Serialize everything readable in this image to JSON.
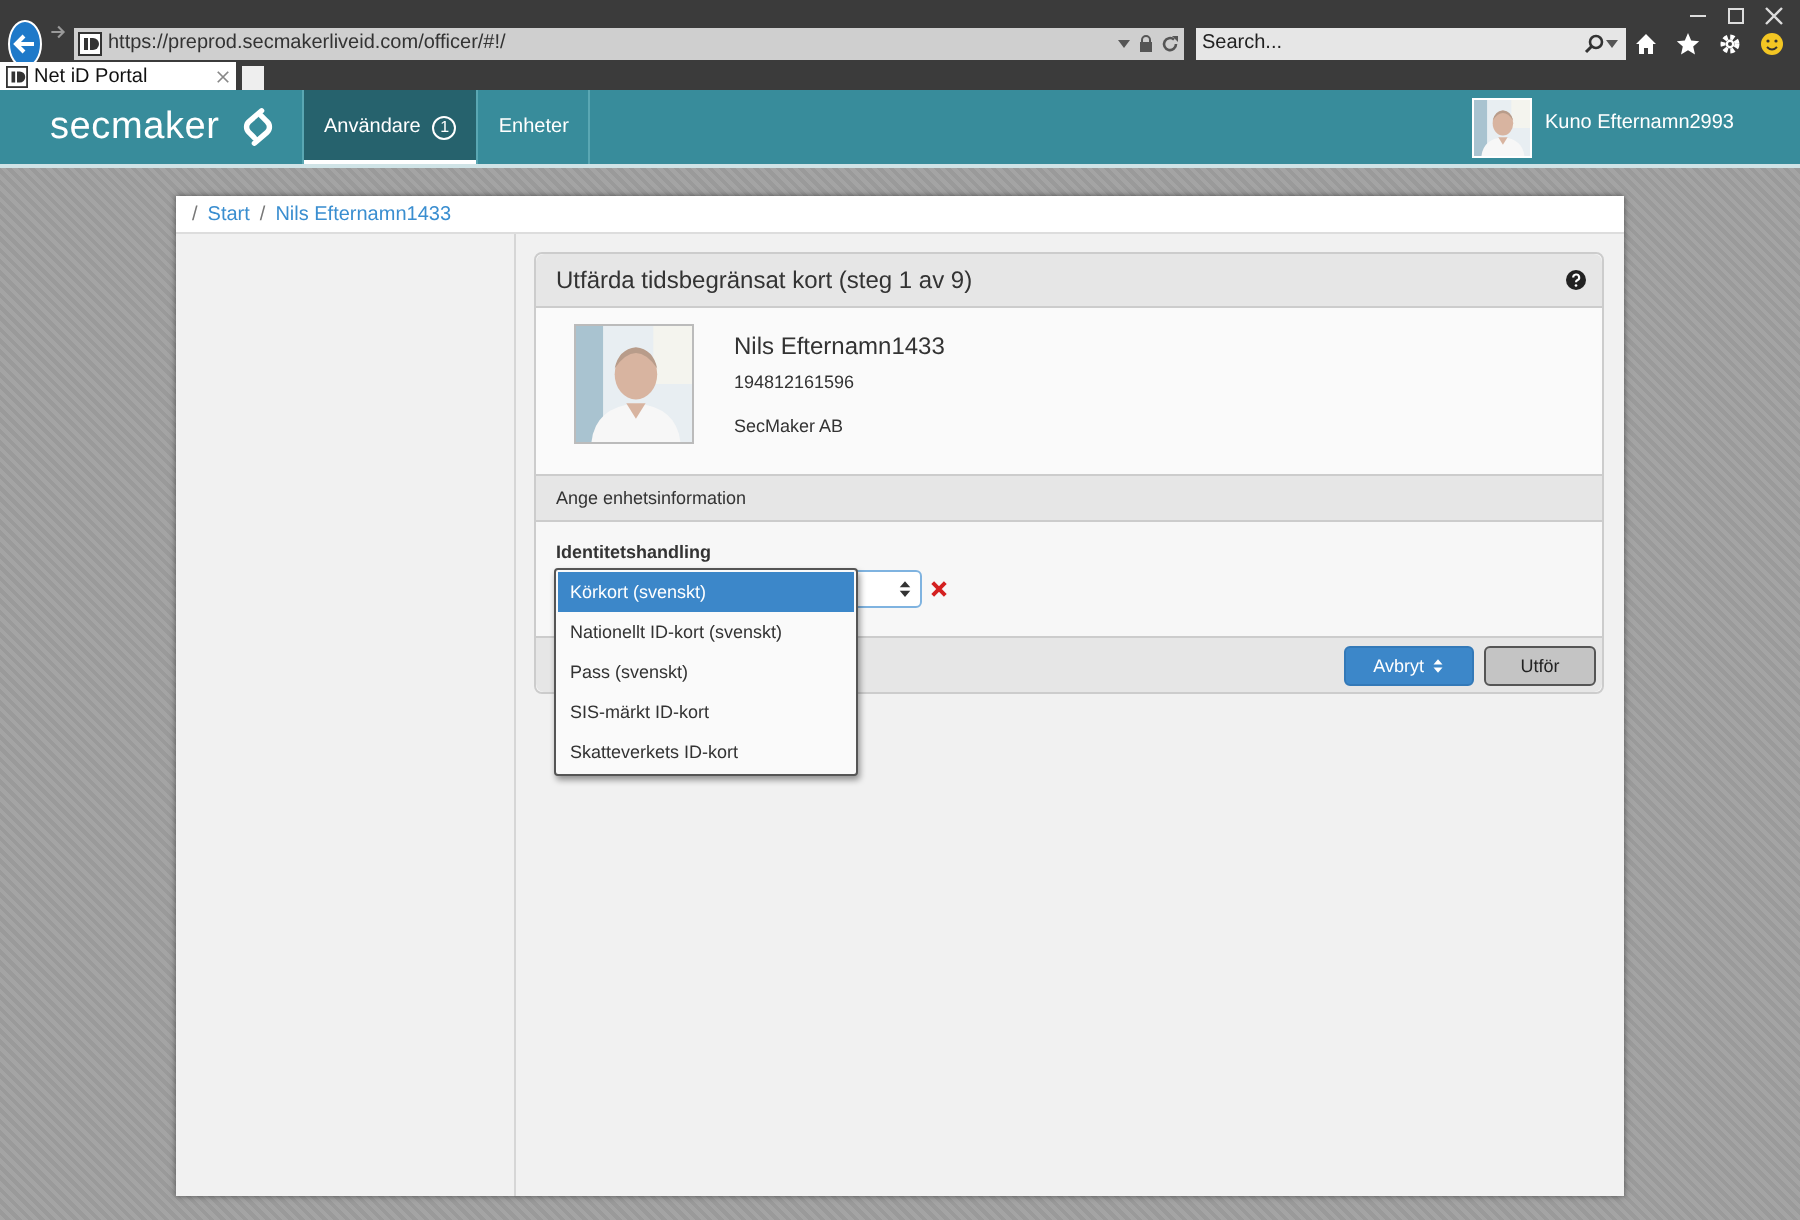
{
  "browser": {
    "address": "https://preprod.secmakerliveid.com/officer/#!/",
    "search": {
      "placeholder": "Search..."
    },
    "tabs": [
      {
        "label": "Net iD Portal",
        "selected": true
      }
    ]
  },
  "header": {
    "logo": "secmaker",
    "nav": [
      {
        "label": "Användare",
        "badge": "1",
        "selected": true
      },
      {
        "label": "Enheter",
        "selected": false
      }
    ],
    "user": "Kuno Efternamn2993"
  },
  "breadcrumb": [
    {
      "separator": "/",
      "label": "Start"
    },
    {
      "separator": "/",
      "label": "Nils Efternamn1433"
    }
  ],
  "card": {
    "title": "Utfärda tidsbegränsat kort (steg 1 av 9)",
    "person": {
      "name": "Nils Efternamn1433",
      "number": "194812161596",
      "organization": "SecMaker AB"
    },
    "section": "Ange enhetsinformation",
    "field": {
      "label": "Identitetshandling",
      "expanded": true,
      "options": [
        {
          "label": "Körkort (svenskt)",
          "selected": true
        },
        {
          "label": "Nationellt ID-kort (svenskt)",
          "selected": false
        },
        {
          "label": "Pass (svenskt)",
          "selected": false
        },
        {
          "label": "SIS-märkt ID-kort",
          "selected": false
        },
        {
          "label": "Skatteverkets ID-kort",
          "selected": false
        }
      ]
    },
    "buttons": [
      {
        "label": "Avbryt",
        "kind": "primary"
      },
      {
        "label": "Utför",
        "kind": "default"
      }
    ]
  }
}
